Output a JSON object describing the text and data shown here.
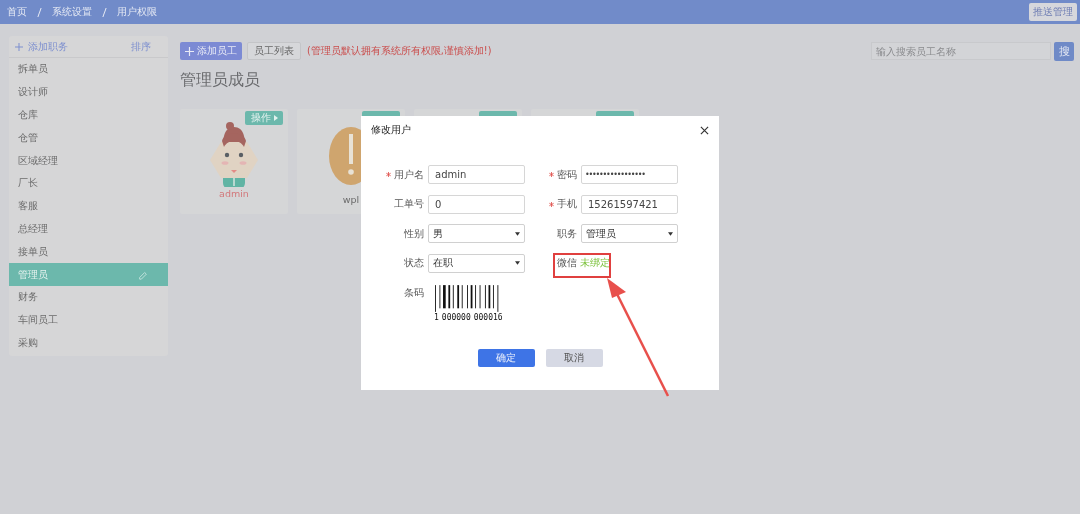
{
  "breadcrumb": [
    "首页",
    "系统设置",
    "用户权限"
  ],
  "top_button": "推送管理",
  "sidebar": {
    "add_label": "添加职务",
    "sort_label": "排序",
    "items": [
      {
        "label": "拆单员",
        "selected": false
      },
      {
        "label": "设计师",
        "selected": false
      },
      {
        "label": "仓库",
        "selected": false
      },
      {
        "label": "仓管",
        "selected": false
      },
      {
        "label": "区域经理",
        "selected": false
      },
      {
        "label": "厂长",
        "selected": false
      },
      {
        "label": "客服",
        "selected": false
      },
      {
        "label": "总经理",
        "selected": false
      },
      {
        "label": "接单员",
        "selected": false
      },
      {
        "label": "管理员",
        "selected": true
      },
      {
        "label": "财务",
        "selected": false
      },
      {
        "label": "车间员工",
        "selected": false
      },
      {
        "label": "采购",
        "selected": false
      }
    ]
  },
  "toolbar": {
    "add_button": "添加员工",
    "list_button": "员工列表",
    "warning": "(管理员默认拥有系统所有权限,谨慎添加!)",
    "search": {
      "placeholder": "输入搜索员工名称",
      "button": "搜"
    }
  },
  "section_title": "管理员成员",
  "members": [
    {
      "kind": "person",
      "name": "admin",
      "highlighted": true,
      "action": "操作"
    },
    {
      "kind": "alert",
      "name": "wpl",
      "highlighted": false
    },
    {
      "kind": "covered"
    },
    {
      "kind": "covered"
    }
  ],
  "dialog": {
    "title": "修改用户",
    "fields": [
      {
        "kind": "text",
        "label": "用户名",
        "required": true,
        "value": "admin"
      },
      {
        "kind": "password",
        "label": "密码",
        "required": true,
        "value": "•••••••••••••••••"
      },
      {
        "kind": "text",
        "label": "工单号",
        "required": false,
        "value": "0"
      },
      {
        "kind": "text",
        "label": "手机",
        "required": true,
        "value": "15261597421"
      },
      {
        "kind": "select",
        "label": "性别",
        "required": false,
        "value": "男"
      },
      {
        "kind": "select",
        "label": "职务",
        "required": false,
        "value": "管理员"
      },
      {
        "kind": "select",
        "label": "状态",
        "required": false,
        "value": "在职"
      },
      {
        "kind": "status",
        "label": "微信",
        "required": false,
        "value": "未绑定",
        "highlighted": true
      },
      {
        "kind": "barcode",
        "label": "条码",
        "required": false,
        "digits": [
          "1",
          "000000",
          "000016"
        ]
      }
    ],
    "buttons": [
      {
        "label": "确定",
        "kind": "primary"
      },
      {
        "label": "取消",
        "kind": "secondary"
      }
    ]
  }
}
